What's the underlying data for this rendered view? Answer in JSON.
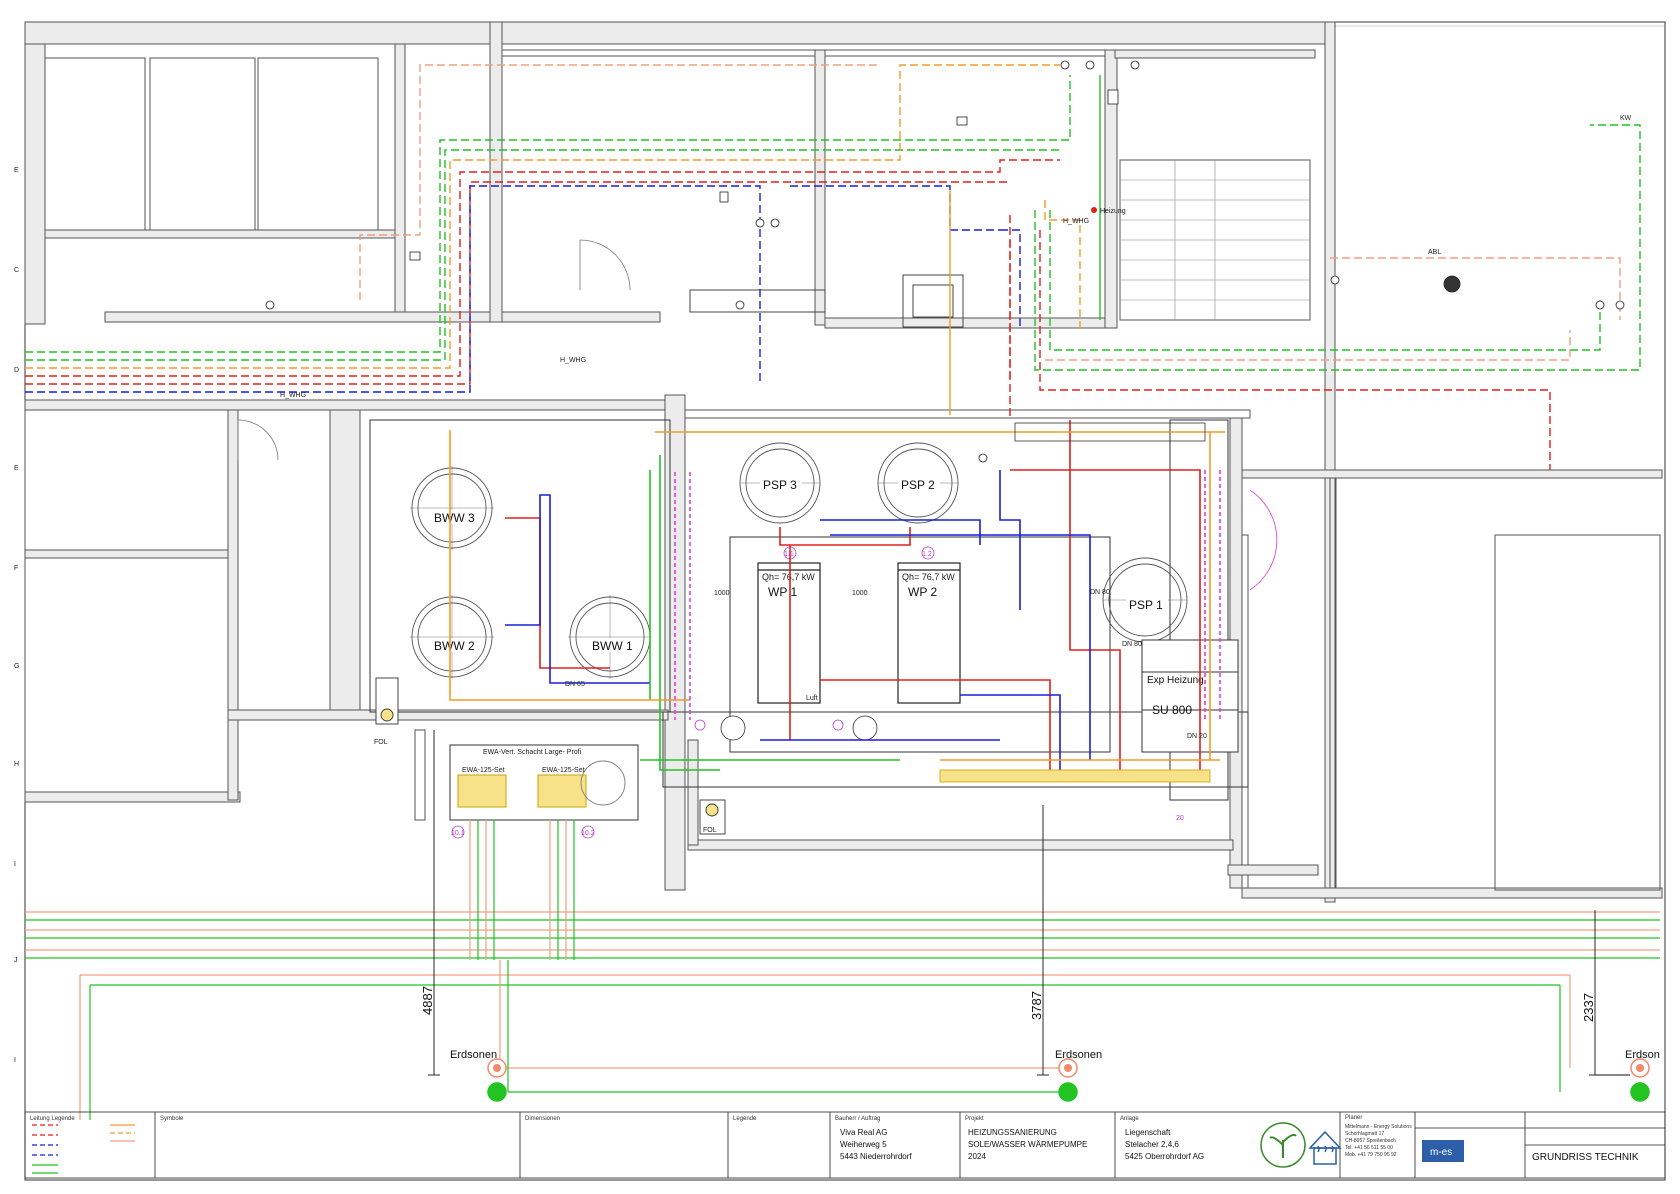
{
  "drawing": {
    "room_labels": {
      "bww3": "BWW 3",
      "bww2": "BWW 2",
      "bww1": "BWW 1",
      "psp3": "PSP 3",
      "psp2": "PSP 2",
      "psp1": "PSP 1",
      "wp1": "WP 1",
      "wp2": "WP 2",
      "wp1_power": "Qh= 76,7 kW",
      "wp2_power": "Qh= 76,7 kW",
      "wp1_tag": "1.1",
      "wp2_tag": "1.2",
      "exp_heizung": "Exp Heizung",
      "su800": "SU 800",
      "heizung": "Heizung",
      "h_whg_1": "H_WHG",
      "h_whg_2": "H_WHG",
      "h_whg_3": "H_WHG",
      "dn65": "DN 65",
      "dn80_a": "DN 80",
      "dn80_b": "DN 80",
      "dn20": "DN 20",
      "luft": "Luft",
      "fol_1": "FOL",
      "fol_2": "FOL",
      "ewa_schacht": "EWA-Vert. Schacht Large- Profi",
      "ewa_125_a": "EWA-125-Set",
      "ewa_125_b": "EWA-125-Set",
      "dim_1000_a": "1000",
      "dim_1000_b": "1000",
      "tag_101": "10.1",
      "tag_102": "10.2",
      "tag_20": "20",
      "kw": "KW",
      "abl": "ABL"
    },
    "dimensions": {
      "d1": "4887",
      "d2": "3787",
      "d3": "2337"
    },
    "probes": {
      "p1": "Erdsonen",
      "p2": "Erdsonen",
      "p3": "Erdson"
    },
    "row_letters": [
      "E",
      "C",
      "D",
      "E",
      "F",
      "G",
      "H",
      "I",
      "J",
      "I"
    ]
  },
  "title_block": {
    "client_heading": "Bauherr / Auftrag",
    "client_name": "Viva Real AG",
    "client_street": "Weiherweg 5",
    "client_city": "5443 Niederrohrdorf",
    "project_heading": "Projekt",
    "project_line1": "HEIZUNGSSANIERUNG",
    "project_line2": "SOLE/WASSER WÄRMEPUMPE",
    "project_year": "2024",
    "site_heading": "Anlage",
    "site_name": "Liegenschaft",
    "site_street": "Stelacher 2,4,6",
    "site_city": "5425 Oberrohrdorf AG",
    "planner_heading": "Planer",
    "planner_name": "Mittelmann - Energy Solutions",
    "planner_street": "Schorhlagmatt 17",
    "planner_city": "CH-8957 Spreitenbach",
    "planner_tel": "Tel. +41 56 511 55 00",
    "planner_mob": "Mob. +41 79 750 95 92",
    "logo_text": "m-es",
    "sheet_title": "GRUNDRISS TECHNIK",
    "legend_heading": "Leitung Legende",
    "symbols_heading": "Symbole",
    "dims_heading": "Dimensionen",
    "notes_heading": "Legende"
  },
  "colors": {
    "wall": "#555555",
    "red": "#e0201b",
    "blue": "#1a1fd6",
    "green": "#22c322",
    "orange": "#f39b2a",
    "salmon": "#f0a080",
    "magenta": "#e23be2",
    "probe": "#f08a6a",
    "probe_green": "#22c322"
  }
}
